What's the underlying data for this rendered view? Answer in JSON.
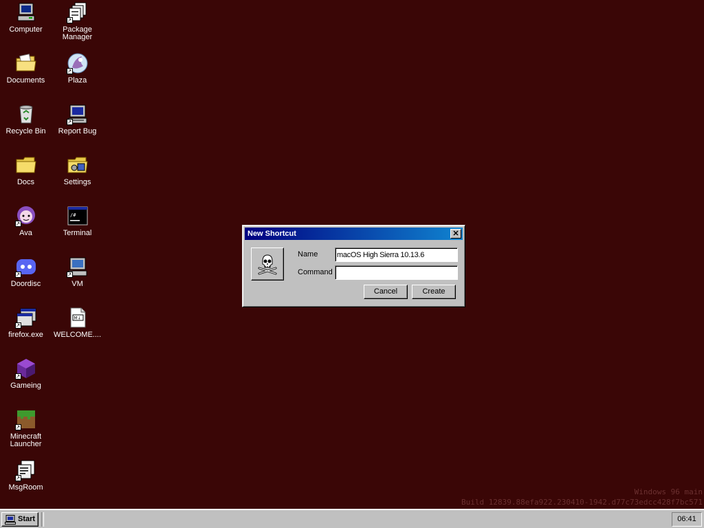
{
  "desktop": {
    "icons": [
      {
        "label": "Computer",
        "icon": "computer-icon"
      },
      {
        "label": "Package Manager",
        "icon": "package-manager-icon"
      },
      {
        "label": "Documents",
        "icon": "documents-folder-icon"
      },
      {
        "label": "Plaza",
        "icon": "plaza-icon"
      },
      {
        "label": "Recycle Bin",
        "icon": "recycle-bin-icon"
      },
      {
        "label": "Report Bug",
        "icon": "report-bug-icon"
      },
      {
        "label": "Docs",
        "icon": "folder-icon"
      },
      {
        "label": "Settings",
        "icon": "settings-folder-icon"
      },
      {
        "label": "Ava",
        "icon": "ava-icon"
      },
      {
        "label": "Terminal",
        "icon": "terminal-icon"
      },
      {
        "label": "Doordisc",
        "icon": "doordisc-icon"
      },
      {
        "label": "VM",
        "icon": "vm-icon"
      },
      {
        "label": "firefox.exe",
        "icon": "window-app-icon"
      },
      {
        "label": "WELCOME....",
        "icon": "markdown-file-icon"
      },
      {
        "label": "Gameing",
        "icon": "cube-icon"
      },
      {
        "label": "Minecraft Launcher",
        "icon": "grass-block-icon"
      },
      {
        "label": "MsgRoom",
        "icon": "msgroom-icon"
      }
    ]
  },
  "dialog": {
    "title": "New Shortcut",
    "close_glyph": "✕",
    "icon": "skull-crossbones-icon",
    "name_label": "Name",
    "name_value": "macOS High Sierra 10.13.6",
    "command_label": "Command",
    "command_value": "",
    "cancel_label": "Cancel",
    "create_label": "Create"
  },
  "watermark": {
    "line1": "Windows 96 main",
    "line2": "Build 12839.88efa922.230410-1942.d77c73edcc428f7bc571"
  },
  "taskbar": {
    "start_label": "Start",
    "clock": "06:41"
  }
}
